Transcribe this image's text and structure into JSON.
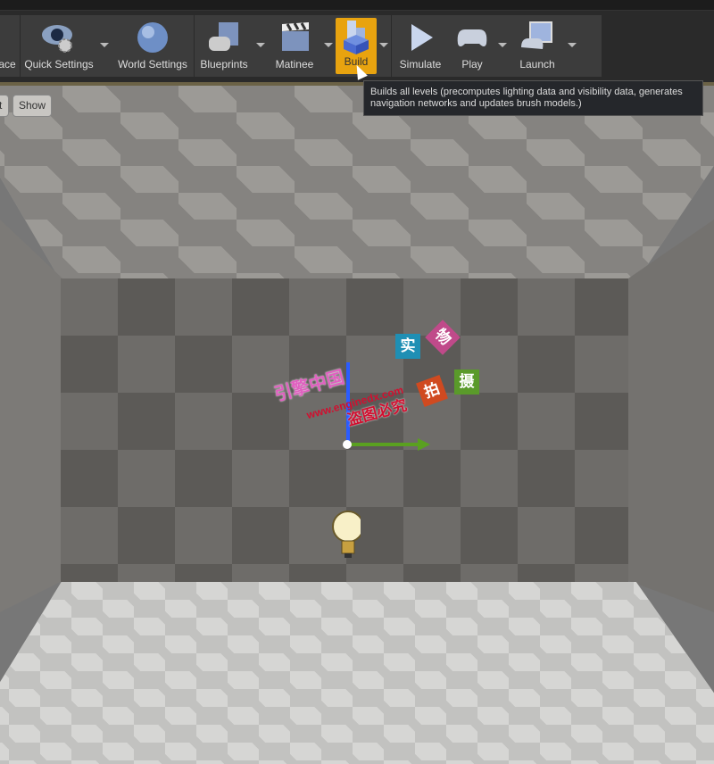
{
  "toolbar": {
    "items": [
      {
        "label": "ace",
        "icon": "place-mode-icon"
      },
      {
        "label": "Quick Settings",
        "icon": "eye-gear-icon",
        "dropdown": true
      },
      {
        "label": "World Settings",
        "icon": "globe-icon"
      },
      {
        "label": "Blueprints",
        "icon": "blueprint-gamepad-icon",
        "dropdown": true
      },
      {
        "label": "Matinee",
        "icon": "clapperboard-icon",
        "dropdown": true
      },
      {
        "label": "Build",
        "icon": "build-blocks-icon",
        "dropdown": true,
        "active": true
      },
      {
        "label": "Simulate",
        "icon": "play-triangle-icon"
      },
      {
        "label": "Play",
        "icon": "gamepad-icon",
        "dropdown": true
      },
      {
        "label": "Launch",
        "icon": "monitor-gamepad-icon",
        "dropdown": true
      }
    ],
    "active_color": "#e8a30f"
  },
  "tooltip": {
    "text": "Builds all levels (precomputes lighting data and visibility data, generates navigation networks and updates brush models.)"
  },
  "viewport": {
    "buttons": [
      "t",
      "Show"
    ]
  },
  "watermark": {
    "line1": "引擎中国",
    "line2": "www.enginedx.com",
    "line3": "盗图必究",
    "tiles": [
      "实",
      "物",
      "拍",
      "摄"
    ]
  }
}
